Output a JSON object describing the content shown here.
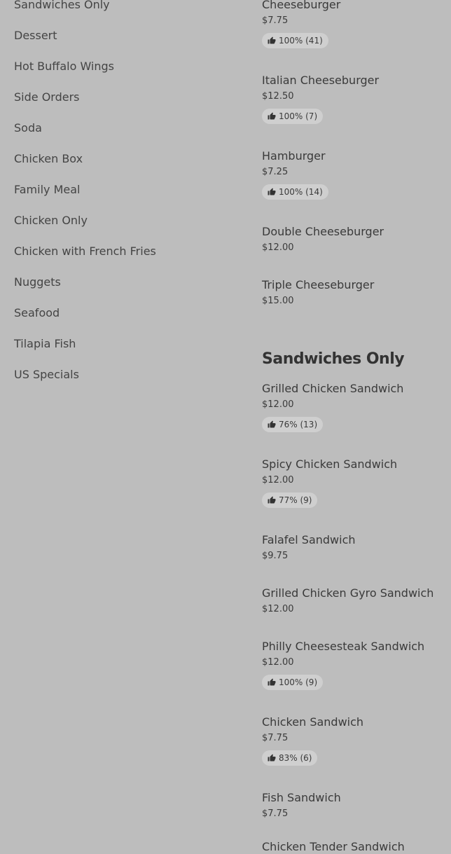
{
  "sidebar": {
    "categories": [
      "Sandwiches Only",
      "Dessert",
      "Hot Buffalo Wings",
      "Side Orders",
      "Soda",
      "Chicken Box",
      "Family Meal",
      "Chicken Only",
      "Chicken with French Fries",
      "Nuggets",
      "Seafood",
      "Tilapia Fish",
      "US Specials"
    ]
  },
  "burgers_section": {
    "items": [
      {
        "name": "Cheeseburger",
        "price": "$7.75",
        "rating": "100% (41)"
      },
      {
        "name": "Italian Cheeseburger",
        "price": "$12.50",
        "rating": "100% (7)"
      },
      {
        "name": "Hamburger",
        "price": "$7.25",
        "rating": "100% (14)"
      },
      {
        "name": "Double Cheeseburger",
        "price": "$12.00",
        "rating": ""
      },
      {
        "name": "Triple Cheeseburger",
        "price": "$15.00",
        "rating": ""
      }
    ]
  },
  "sandwiches_section": {
    "title": "Sandwiches Only",
    "items": [
      {
        "name": "Grilled Chicken Sandwich",
        "price": "$12.00",
        "rating": "76% (13)"
      },
      {
        "name": "Spicy Chicken Sandwich",
        "price": "$12.00",
        "rating": "77% (9)"
      },
      {
        "name": "Falafel Sandwich",
        "price": "$9.75",
        "rating": ""
      },
      {
        "name": "Grilled Chicken Gyro Sandwich",
        "price": "$12.00",
        "rating": ""
      },
      {
        "name": "Philly Cheesesteak Sandwich",
        "price": "$12.00",
        "rating": "100% (9)"
      },
      {
        "name": "Chicken Sandwich",
        "price": "$7.75",
        "rating": "83% (6)"
      },
      {
        "name": "Fish Sandwich",
        "price": "$7.75",
        "rating": ""
      },
      {
        "name": "Chicken Tender Sandwich",
        "price": "",
        "rating": ""
      }
    ]
  }
}
